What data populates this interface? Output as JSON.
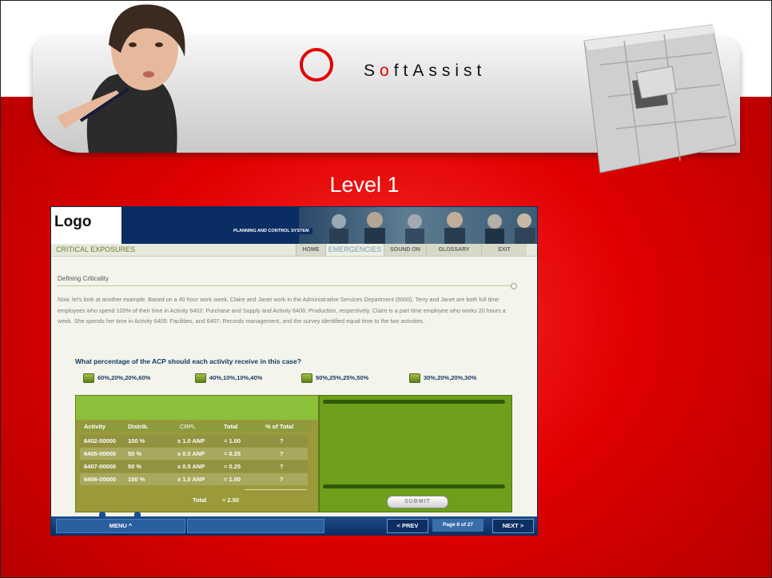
{
  "brand": {
    "name_lead": "S",
    "name_o": "o",
    "name_rest": "ftAssist",
    "accent": "#e00000"
  },
  "level": "Level 1",
  "app": {
    "logo": "Logo",
    "header_banner": "PLANNING AND CONTROL SYSTEM",
    "section": "CRITICAL EXPOSURES",
    "nav": [
      "HOME",
      "EMERGENCIES",
      "SOUND ON",
      "GLOSSARY",
      "EXIT"
    ],
    "subtitle": "Defining Criticality",
    "paragraph": "Now, let's look at another example. Based on a 40 hour work week, Claire and Janet work in the Administrative Services Department (6000). Terry and Janet are both full time employees who spend 100% of their time in Activity 6402: Purchase and Supply and Activity 6406: Production, respectively. Claire is a part time employee who works 20 hours a week. She spends her time in Activity 6405: Facilities, and 6407: Records management, and the survey identified equal time to the two activities.",
    "question": "What percentage of the ACP should each activity receive in this case?",
    "options": [
      "60%,20%,20%,60%",
      "40%,10%,10%,40%",
      "50%,25%,25%,50%",
      "30%,20%,20%,30%"
    ],
    "table": {
      "headers": [
        "Activity",
        "Distrib.",
        "CRPL",
        "Total",
        "% of Total"
      ],
      "rows": [
        [
          "6402-00000",
          "100 %",
          "x 1.0 ANP",
          "= 1.00",
          "?"
        ],
        [
          "6405-00000",
          "50 %",
          "x 0.5 ANP",
          "= 0.25",
          "?"
        ],
        [
          "6407-00000",
          "50 %",
          "x 0.5 ANP",
          "= 0.25",
          "?"
        ],
        [
          "6406-00000",
          "100 %",
          "x 1.0 ANP",
          "= 1.00",
          "?"
        ]
      ],
      "total_label": "Total",
      "total_value": "= 2.50"
    },
    "submit": "SUBMIT",
    "footer": {
      "menu": "MENU ^",
      "prev": "< PREV",
      "page": "Page 8 of 27",
      "next": "NEXT >"
    }
  }
}
